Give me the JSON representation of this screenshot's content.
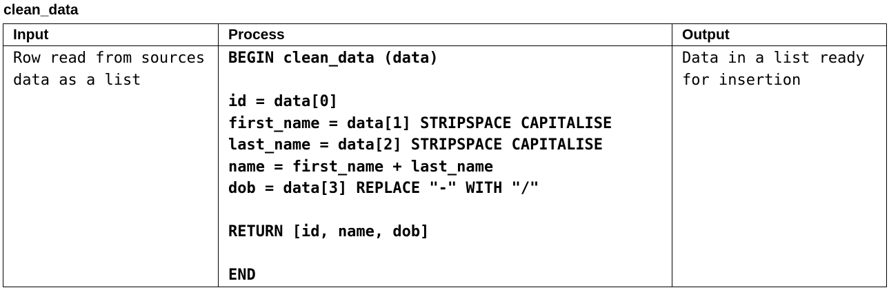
{
  "document": {
    "title": "clean_data"
  },
  "table": {
    "headers": {
      "input": "Input",
      "process": "Process",
      "output": "Output"
    },
    "input_text": "Row read from sources data as a list",
    "process_lines": [
      "BEGIN clean_data (data)",
      "",
      "id = data[0]",
      "first_name = data[1] STRIPSPACE CAPITALISE",
      "last_name = data[2] STRIPSPACE CAPITALISE",
      "name = first_name + last_name",
      "dob = data[3] REPLACE \"-\" WITH \"/\"",
      "",
      "RETURN [id, name, dob]",
      "",
      "END"
    ],
    "output_text": "Data in a list ready for insertion"
  }
}
